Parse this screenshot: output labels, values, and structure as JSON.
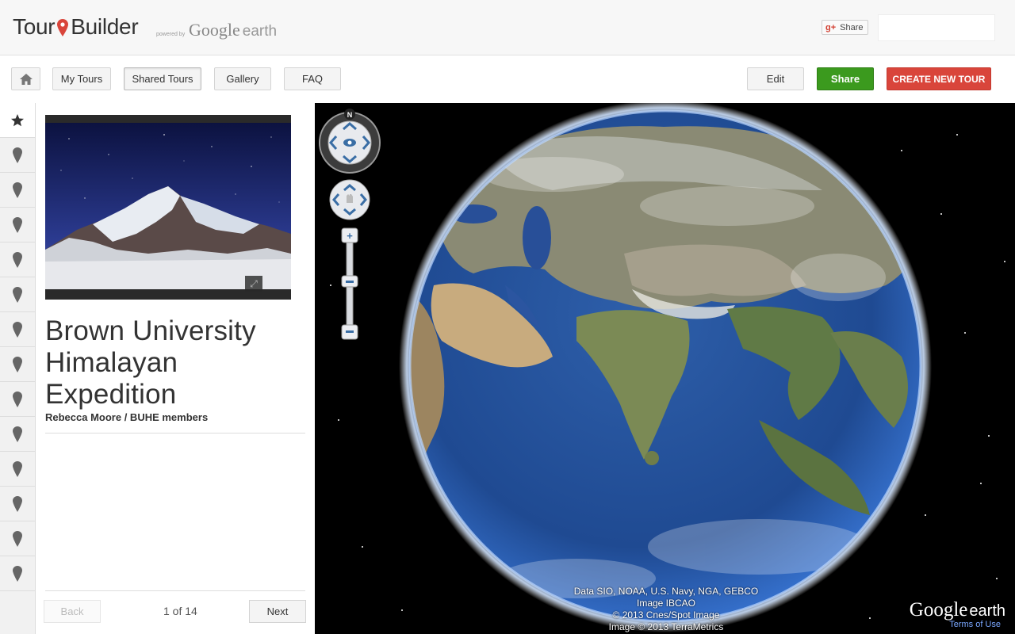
{
  "header": {
    "logo_left": "Tour",
    "logo_right": "Builder",
    "powered_by": "powered by",
    "google": "Google",
    "earth": "earth",
    "gplus_icon": "g+",
    "gplus_label": "Share"
  },
  "toolbar": {
    "home_icon": "home-icon",
    "my_tours": "My Tours",
    "shared_tours": "Shared Tours",
    "gallery": "Gallery",
    "faq": "FAQ",
    "edit": "Edit",
    "share": "Share",
    "create": "CREATE NEW TOUR"
  },
  "rail": {
    "items": [
      "star-icon",
      "pin-icon",
      "pin-icon",
      "pin-icon",
      "pin-icon",
      "pin-icon",
      "pin-icon",
      "pin-icon",
      "pin-icon",
      "pin-icon",
      "pin-icon",
      "pin-icon",
      "pin-icon",
      "pin-icon"
    ]
  },
  "story": {
    "title": "Brown University Himalayan Expedition",
    "author": "Rebecca Moore / BUHE members",
    "back": "Back",
    "page_count": "1 of 14",
    "next": "Next"
  },
  "map": {
    "compass_label": "N",
    "attribution": [
      "Data SIO, NOAA, U.S. Navy, NGA, GEBCO",
      "Image IBCAO",
      "© 2013 Cnes/Spot Image",
      "Image © 2013 TerraMetrics"
    ],
    "logo_google": "Google",
    "logo_earth": "earth",
    "terms": "Terms of Use"
  },
  "colors": {
    "share_green": "#3b9a1e",
    "create_red": "#d9453b",
    "logo_pin": "#d9453b"
  }
}
